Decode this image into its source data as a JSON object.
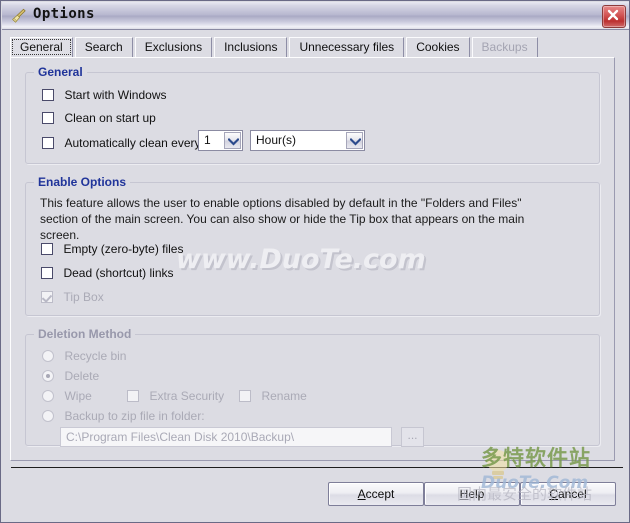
{
  "window": {
    "title": "Options",
    "icon": "broom-icon",
    "close_label": "×"
  },
  "tabs": [
    {
      "label": "General",
      "active": true,
      "disabled": false
    },
    {
      "label": "Search",
      "active": false,
      "disabled": false
    },
    {
      "label": "Exclusions",
      "active": false,
      "disabled": false
    },
    {
      "label": "Inclusions",
      "active": false,
      "disabled": false
    },
    {
      "label": "Unnecessary files",
      "active": false,
      "disabled": false
    },
    {
      "label": "Cookies",
      "active": false,
      "disabled": false
    },
    {
      "label": "Backups",
      "active": false,
      "disabled": true
    }
  ],
  "general_group": {
    "title": "General",
    "start_with_windows": {
      "label": "Start with Windows",
      "checked": false
    },
    "clean_on_start_up": {
      "label": "Clean on start up",
      "checked": false
    },
    "auto_clean": {
      "label": "Automatically clean every",
      "checked": false
    },
    "interval_value": "1",
    "interval_unit": "Hour(s)"
  },
  "enable_options_group": {
    "title": "Enable Options",
    "description": "This feature allows the user to enable options disabled by default in the \"Folders and Files\" section of the main screen. You can also show or hide the Tip box that appears on the main screen.",
    "empty_files": {
      "label": "Empty (zero-byte) files",
      "checked": false
    },
    "dead_links": {
      "label": "Dead (shortcut) links",
      "checked": false
    },
    "tip_box": {
      "label": "Tip Box",
      "checked": true,
      "disabled": true
    }
  },
  "deletion_method_group": {
    "title": "Deletion Method",
    "disabled": true,
    "recycle_bin": {
      "label": "Recycle bin",
      "selected": false
    },
    "delete": {
      "label": "Delete",
      "selected": true
    },
    "wipe": {
      "label": "Wipe",
      "selected": false
    },
    "extra_security": {
      "label": "Extra Security",
      "checked": false
    },
    "rename": {
      "label": "Rename",
      "checked": false
    },
    "backup_zip": {
      "label": "Backup to zip file in folder:",
      "selected": false
    },
    "backup_path": "C:\\Program Files\\Clean Disk 2010\\Backup\\",
    "browse_label": "..."
  },
  "footer": {
    "accept": {
      "label": "Accept",
      "mnemonic": "A"
    },
    "help": {
      "label": "Help",
      "mnemonic": "H"
    },
    "cancel": {
      "label": "Cancel",
      "mnemonic": "C"
    }
  },
  "watermarks": {
    "center": "www.DuoTe.com",
    "logo_cn": "多特软件站",
    "logo_en": "DuoTe.Com",
    "tagline_cn": "国内最安全的软件站"
  },
  "colors": {
    "dialog_bg": "#dcdce3",
    "group_title": "#20349a",
    "close_button": "#bc3030",
    "disabled_text": "#aaaab6"
  }
}
